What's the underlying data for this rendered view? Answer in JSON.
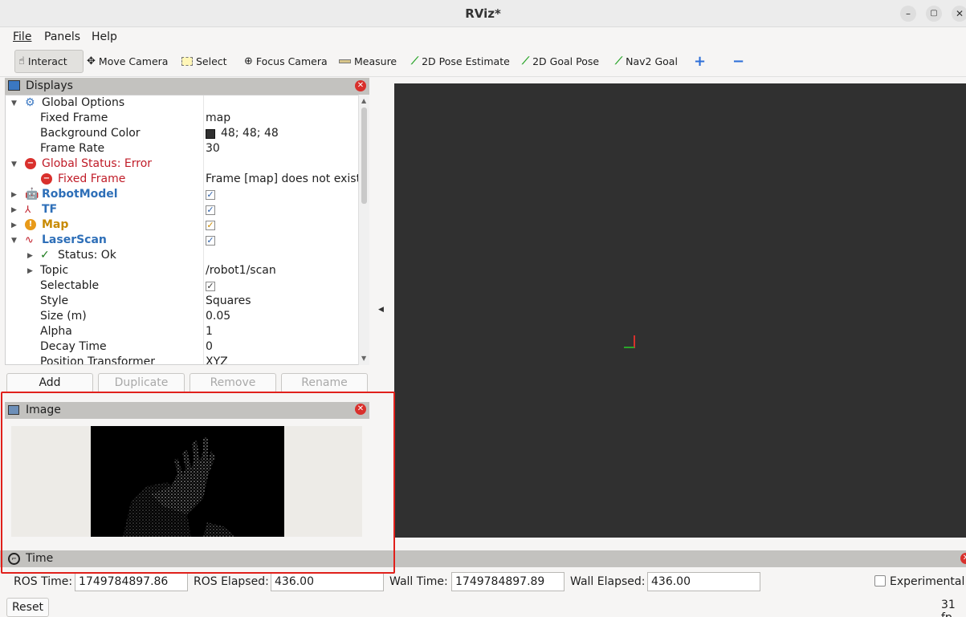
{
  "window": {
    "title": "RViz*",
    "minimize": "–",
    "maximize": "▢",
    "close": "✕"
  },
  "menu": {
    "file": "File",
    "panels": "Panels",
    "help": "Help"
  },
  "toolbar": {
    "interact": "Interact",
    "move_camera": "Move Camera",
    "select": "Select",
    "focus_camera": "Focus Camera",
    "measure": "Measure",
    "pose_estimate": "2D Pose Estimate",
    "goal_pose": "2D Goal Pose",
    "nav2_goal": "Nav2 Goal",
    "add_icon": "+",
    "remove_icon": "−"
  },
  "displays": {
    "title": "Displays",
    "rows": [
      {
        "name": "Global Options",
        "value": ""
      },
      {
        "name": "Fixed Frame",
        "value": "map"
      },
      {
        "name": "Background Color",
        "value": "48; 48; 48"
      },
      {
        "name": "Frame Rate",
        "value": "30"
      },
      {
        "name": "Global Status: Error",
        "value": ""
      },
      {
        "name": "Fixed Frame",
        "value": "Frame [map] does not exist"
      },
      {
        "name": "RobotModel",
        "value": ""
      },
      {
        "name": "TF",
        "value": ""
      },
      {
        "name": "Map",
        "value": ""
      },
      {
        "name": "LaserScan",
        "value": ""
      },
      {
        "name": "Status: Ok",
        "value": ""
      },
      {
        "name": "Topic",
        "value": "/robot1/scan"
      },
      {
        "name": "Selectable",
        "value": ""
      },
      {
        "name": "Style",
        "value": "Squares"
      },
      {
        "name": "Size (m)",
        "value": "0.05"
      },
      {
        "name": "Alpha",
        "value": "1"
      },
      {
        "name": "Decay Time",
        "value": "0"
      },
      {
        "name": "Position Transformer",
        "value": "XYZ"
      }
    ],
    "buttons": {
      "add": "Add",
      "duplicate": "Duplicate",
      "remove": "Remove",
      "rename": "Rename"
    }
  },
  "image_panel": {
    "title": "Image"
  },
  "time_panel": {
    "title": "Time",
    "ros_time_label": "ROS Time:",
    "ros_time": "1749784897.86",
    "ros_elapsed_label": "ROS Elapsed:",
    "ros_elapsed": "436.00",
    "wall_time_label": "Wall Time:",
    "wall_time": "1749784897.89",
    "wall_elapsed_label": "Wall Elapsed:",
    "wall_elapsed": "436.00",
    "experimental": "Experimental",
    "reset": "Reset",
    "fps": "31 fp"
  },
  "colors": {
    "viewport_bg": "#303030",
    "error": "#c01c28",
    "highlight": "#e0201b"
  }
}
